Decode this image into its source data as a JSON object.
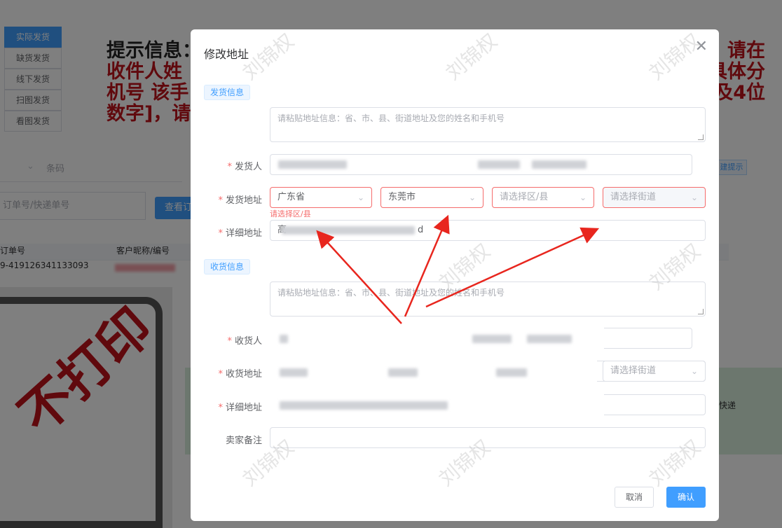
{
  "background": {
    "tabs": [
      "实际发货",
      "缺货发货",
      "线下发货",
      "扫图发货",
      "看图发货"
    ],
    "hint_title": "提示信息：",
    "hint_lines": [
      "收件人姓",
      "机号 该手",
      "数字]，请"
    ],
    "hint_right": [
      "请在",
      "具体分",
      "及4位"
    ],
    "filter_label": "条码",
    "search_placeholder": "订单号/快递单号",
    "search_button": "查看订",
    "table_headers": [
      "订单号",
      "客户昵称/编号"
    ],
    "table_row_order": "9-419126341133093",
    "right_tag": "建提示",
    "right_text": "快递",
    "stamp_text": "不打印"
  },
  "dialog": {
    "title": "修改地址",
    "close_icon": "close-icon",
    "sender_section": "发货信息",
    "receiver_section": "收货信息",
    "paste_placeholder": "请粘贴地址信息：省、市、县、街道地址及您的姓名和手机号",
    "sender_name_label": "发货人",
    "sender_address_label": "发货地址",
    "province": "广东省",
    "city": "东莞市",
    "district_placeholder": "请选择区/县",
    "street_placeholder": "请选择街道",
    "district_error": "请选择区/县",
    "detail_label": "详细地址",
    "detail_value_start": "高",
    "detail_value_end": "d",
    "receiver_name_label": "收货人",
    "receiver_address_label": "收货地址",
    "receiver_street_placeholder": "请选择街道",
    "receiver_detail_label": "详细地址",
    "remark_label": "卖家备注",
    "cancel_button": "取消",
    "confirm_button": "确认"
  },
  "watermark": "刘锦权",
  "colors": {
    "primary": "#409eff",
    "error": "#f56c6c",
    "annotation_arrow": "#e8261e"
  }
}
